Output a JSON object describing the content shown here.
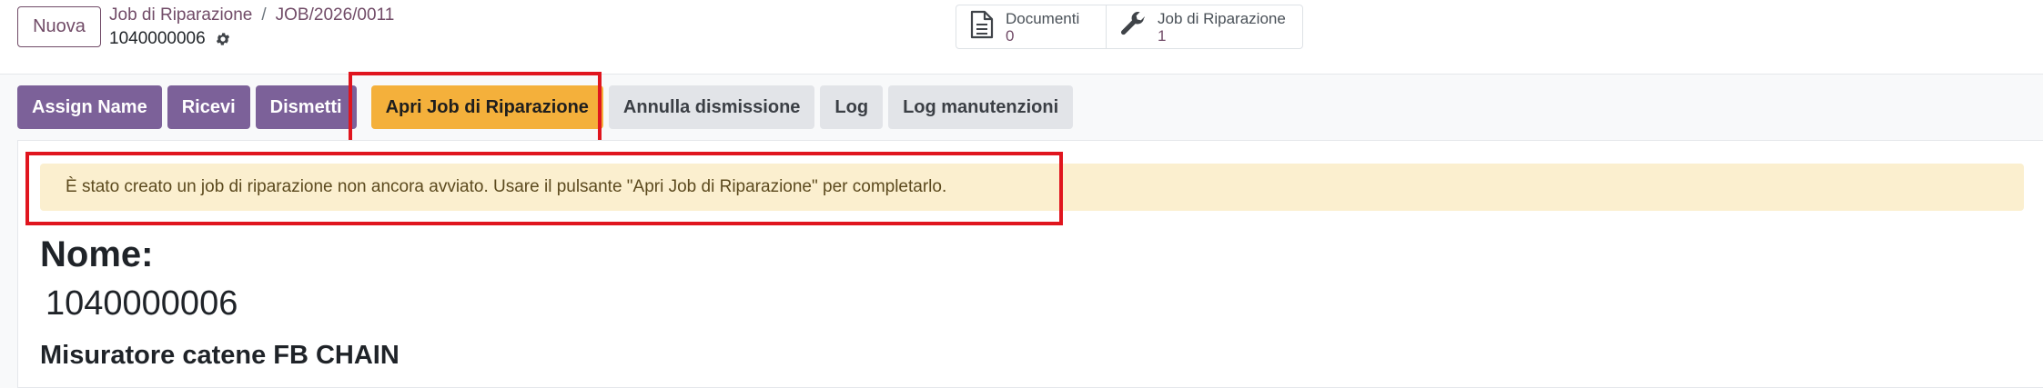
{
  "header": {
    "new_label": "Nuova",
    "breadcrumb": {
      "parent": "Job di Riparazione",
      "separator": "/",
      "current": "JOB/2026/0011"
    },
    "record_id": "1040000006"
  },
  "smart_buttons": [
    {
      "label": "Documenti",
      "count": "0",
      "icon": "document-icon"
    },
    {
      "label": "Job di Riparazione",
      "count": "1",
      "icon": "wrench-icon"
    }
  ],
  "actions": {
    "assign_name": "Assign Name",
    "ricevi": "Ricevi",
    "dismetti": "Dismetti",
    "apri_job": "Apri Job di Riparazione",
    "annulla_dismissione": "Annulla dismissione",
    "log": "Log",
    "log_manutenzioni": "Log manutenzioni"
  },
  "alert": {
    "message": "È stato creato un job di riparazione non ancora avviato. Usare il pulsante \"Apri Job di Riparazione\" per completarlo."
  },
  "form": {
    "name_label": "Nome:",
    "name_value": "1040000006",
    "subtitle": "Misuratore catene FB CHAIN"
  },
  "colors": {
    "brand": "#714b67",
    "primary_button": "#7c6199",
    "warning_button": "#f4b03b",
    "highlight": "#e0151e",
    "alert_bg": "#fbefcf"
  }
}
